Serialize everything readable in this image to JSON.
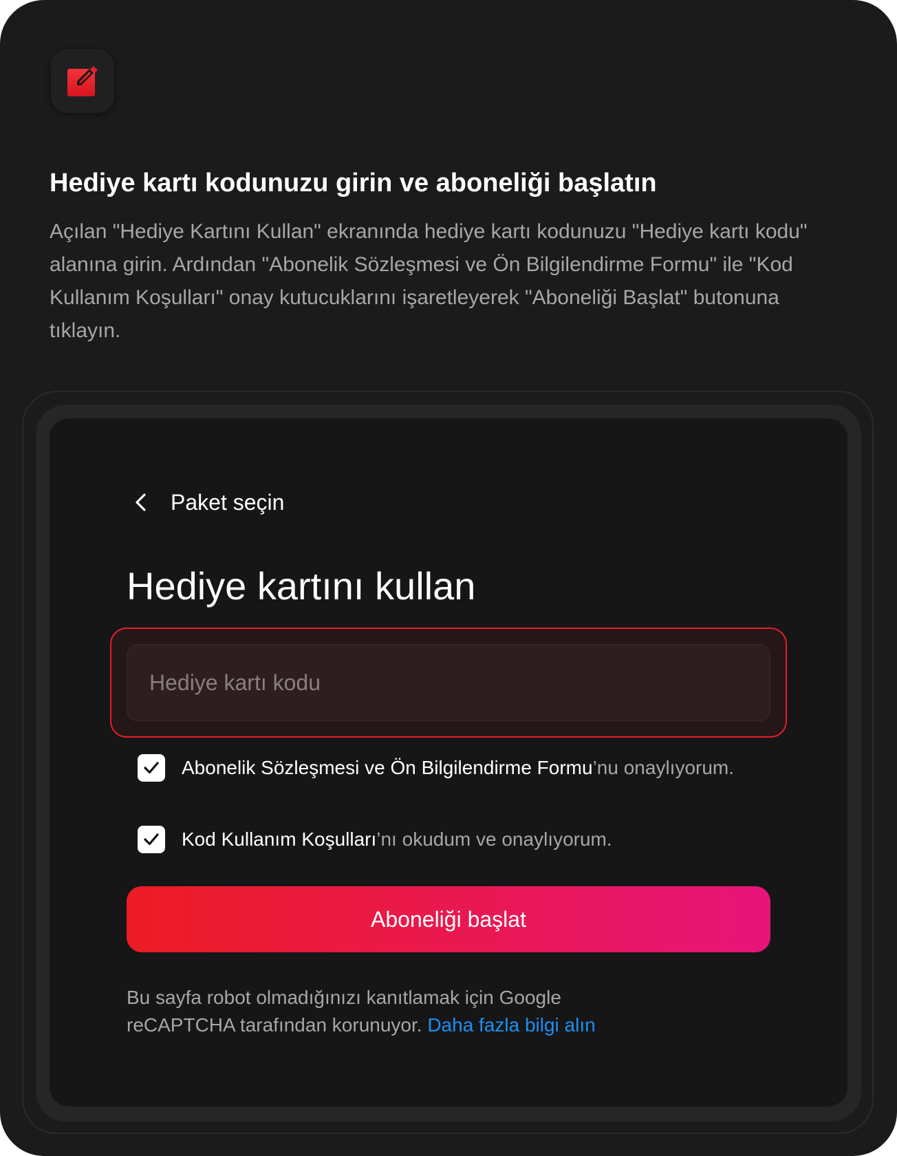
{
  "colors": {
    "background": "#1b1b1c",
    "screen": "#161617",
    "accent_red": "#e41e2a",
    "button_gradient_start": "#ec1c24",
    "button_gradient_end": "#e7157a",
    "link": "#1d8ff2",
    "muted_text": "#a7a7a9"
  },
  "app_icon": {
    "name": "edit-square-icon"
  },
  "instruction": {
    "title": "Hediye kartı kodunuzu girin ve aboneliği başlatın",
    "description": "Açılan \"Hediye Kartını Kullan\" ekranında hediye kartı kodunuzu \"Hediye kartı kodu\" alanına girin. Ardından \"Abonelik Sözleşmesi ve Ön Bilgilendirme Formu\" ile \"Kod Kullanım Koşulları\" onay kutucuklarını işaretleyerek \"Aboneliği Başlat\" butonuna tıklayın."
  },
  "form": {
    "back_icon": "chevron-left-icon",
    "back_label": "Paket seçin",
    "title": "Hediye kartını kullan",
    "code_input": {
      "placeholder": "Hediye kartı kodu",
      "value": ""
    },
    "checkboxes": [
      {
        "checked": true,
        "link_text": "Abonelik Sözleşmesi ve Ön Bilgilendirme Formu",
        "suffix": "’nu onaylıyorum."
      },
      {
        "checked": true,
        "link_text": "Kod Kullanım Koşulları",
        "suffix": "’nı okudum ve onaylıyorum."
      }
    ],
    "submit_label": "Aboneliği başlat",
    "recaptcha_text": "Bu sayfa robot olmadığınızı kanıtlamak için Google reCAPTCHA tarafından korunuyor.",
    "recaptcha_link": "Daha fazla bilgi alın"
  }
}
